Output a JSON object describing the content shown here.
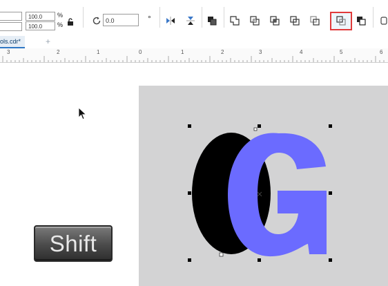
{
  "toolbar": {
    "scale_x": "100.0",
    "scale_y": "100.0",
    "percent_x": "%",
    "percent_y": "%",
    "rotation": "0.0",
    "degree_symbol": "°"
  },
  "document": {
    "tab_label": "ols.cdr*",
    "add_tab": "+"
  },
  "ruler": {
    "numbers": [
      "3",
      "2",
      "1",
      "0",
      "1",
      "2",
      "3",
      "4",
      "5",
      "6"
    ]
  },
  "canvas": {
    "shift_key_label": "Shift",
    "letter_color": "#6b6bff",
    "shadow_color": "#000000",
    "page_color": "#d3d3d4",
    "highlight_color": "#e03a3a"
  }
}
